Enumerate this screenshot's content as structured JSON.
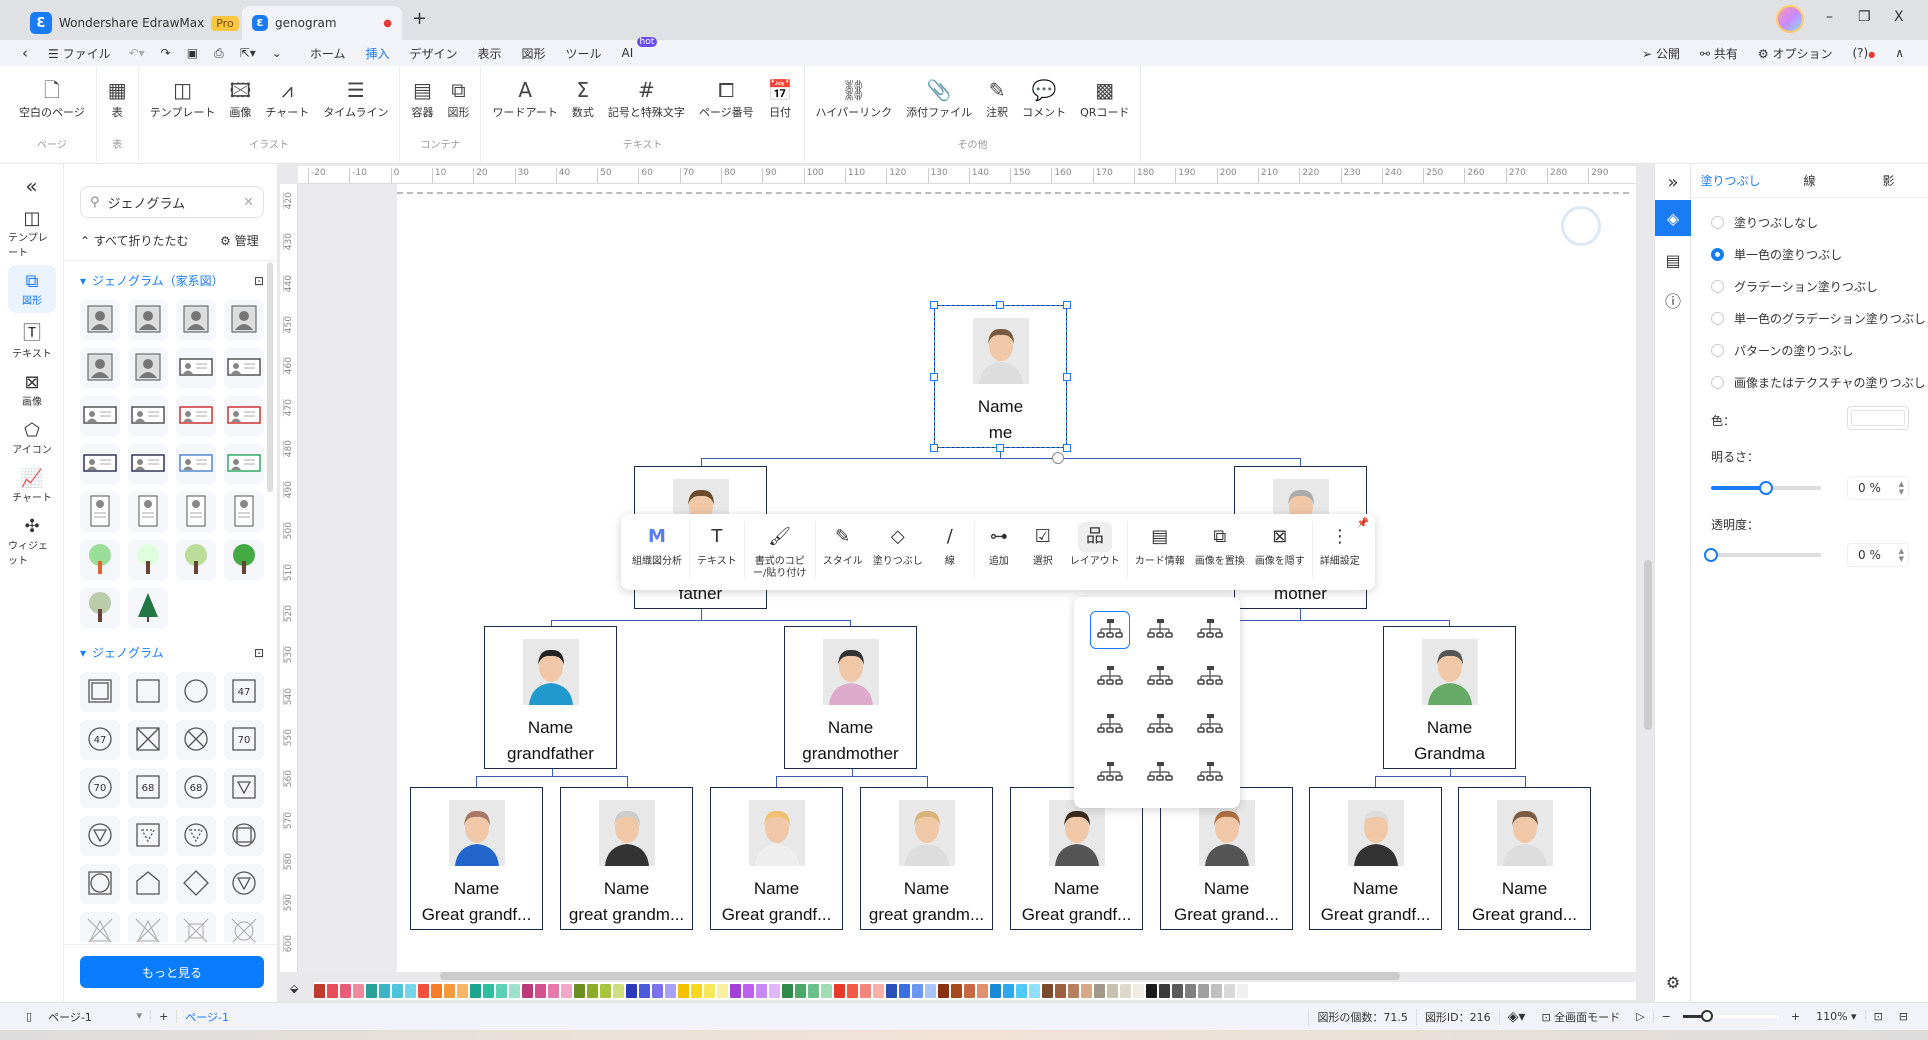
{
  "tabs": {
    "app": "Wondershare EdrawMax",
    "pro": "Pro",
    "doc": "genogram",
    "new_tab": "+"
  },
  "window": {
    "minimize": "–",
    "restore": "❐",
    "close": "X"
  },
  "menu": {
    "file": "ファイル",
    "items": [
      "ホーム",
      "挿入",
      "デザイン",
      "表示",
      "図形",
      "ツール",
      "AI"
    ],
    "active": "挿入",
    "hot": "hot",
    "publish": "公開",
    "share": "共有",
    "options": "オプション",
    "help": "?"
  },
  "ribbon": {
    "groups": [
      {
        "label": "ページ",
        "items": [
          {
            "label": "空白のページ",
            "icon": "blank-page-icon"
          }
        ]
      },
      {
        "label": "表",
        "items": [
          {
            "label": "表",
            "icon": "table-icon"
          }
        ]
      },
      {
        "label": "イラスト",
        "items": [
          {
            "label": "テンプレート",
            "icon": "template-icon"
          },
          {
            "label": "画像",
            "icon": "image-icon"
          },
          {
            "label": "チャート",
            "icon": "chart-icon"
          },
          {
            "label": "タイムライン",
            "icon": "timeline-icon"
          }
        ]
      },
      {
        "label": "コンテナ",
        "items": [
          {
            "label": "容器",
            "icon": "container-icon"
          },
          {
            "label": "図形",
            "icon": "shape-icon"
          }
        ]
      },
      {
        "label": "テキスト",
        "items": [
          {
            "label": "ワードアート",
            "icon": "wordart-icon"
          },
          {
            "label": "数式",
            "icon": "formula-icon"
          },
          {
            "label": "記号と特殊文字",
            "icon": "symbol-icon"
          },
          {
            "label": "ページ番号",
            "icon": "page-number-icon"
          },
          {
            "label": "日付",
            "icon": "date-icon"
          }
        ]
      },
      {
        "label": "その他",
        "items": [
          {
            "label": "ハイパーリンク",
            "icon": "hyperlink-icon"
          },
          {
            "label": "添付ファイル",
            "icon": "attachment-icon"
          },
          {
            "label": "注釈",
            "icon": "annotation-icon"
          },
          {
            "label": "コメント",
            "icon": "comment-icon"
          },
          {
            "label": "QRコード",
            "icon": "qr-code-icon"
          }
        ]
      }
    ]
  },
  "leftbar": [
    {
      "label": "テンプレート"
    },
    {
      "label": "図形"
    },
    {
      "label": "テキスト"
    },
    {
      "label": "画像"
    },
    {
      "label": "アイコン"
    },
    {
      "label": "チャート"
    },
    {
      "label": "ウィジェット"
    }
  ],
  "library": {
    "search": "ジェノグラム",
    "collapse_all": "すべて折りたたむ",
    "manage": "管理",
    "sections": [
      {
        "title": "ジェノグラム（家系図）"
      },
      {
        "title": "ジェノグラム"
      }
    ],
    "section1_icons": [
      "person-square",
      "person-circle",
      "person-frame",
      "person-frame-dark",
      "person-label",
      "person-label-round",
      "id-card",
      "id-card",
      "id-card",
      "id-card",
      "id-card-red",
      "id-card-red",
      "id-card-blue",
      "id-card-blue",
      "id-card-light-blue",
      "id-card-green",
      "portrait-card",
      "portrait-card",
      "portrait-card",
      "portrait-card",
      "tree-orange",
      "tree-pale",
      "tree-light",
      "tree-green",
      "tree-bare",
      "tree-pine"
    ],
    "section2_icons": [
      "double-square",
      "square",
      "circle",
      "square-47",
      "circle-47",
      "square-x",
      "circle-x",
      "square-70",
      "circle-70",
      "square-68",
      "circle-68",
      "square-triangle",
      "circle-triangle",
      "square-dotted-triangle",
      "circle-dotted-triangle",
      "circle-square",
      "square-circle",
      "pentagon",
      "diamond",
      "triangle",
      "cross-triangle",
      "cross-triangle-line",
      "square-cross",
      "circle-cross"
    ],
    "numbers": {
      "n47": "47",
      "n70": "70",
      "n68": "68"
    },
    "more": "もっと見る"
  },
  "ruler": {
    "h": [
      "-20",
      "-10",
      "0",
      "10",
      "20",
      "30",
      "40",
      "50",
      "60",
      "70",
      "80",
      "90",
      "100",
      "110",
      "120",
      "130",
      "140",
      "150",
      "160",
      "170",
      "180",
      "190",
      "200",
      "210",
      "220",
      "230",
      "240",
      "250",
      "260",
      "270",
      "280",
      "290"
    ],
    "v": [
      "420",
      "430",
      "440",
      "450",
      "460",
      "470",
      "480",
      "490",
      "500",
      "510",
      "520",
      "530",
      "540",
      "550",
      "560",
      "570",
      "580",
      "590",
      "600"
    ]
  },
  "tree": {
    "me": {
      "name": "Name",
      "role": "me"
    },
    "father": {
      "name": "Name",
      "role": "father"
    },
    "mother": {
      "name": "Name",
      "role": "mother"
    },
    "gen2": [
      {
        "name": "Name",
        "role": "grandfather"
      },
      {
        "name": "Name",
        "role": "grandmother"
      },
      {
        "name": "Name",
        "role": "Grandma"
      }
    ],
    "gen3": [
      {
        "name": "Name",
        "role": "Great grandf..."
      },
      {
        "name": "Name",
        "role": "great grandm..."
      },
      {
        "name": "Name",
        "role": "Great grandf..."
      },
      {
        "name": "Name",
        "role": "great grandm..."
      },
      {
        "name": "Name",
        "role": "Great grandf..."
      },
      {
        "name": "Name",
        "role": "Great grand..."
      },
      {
        "name": "Name",
        "role": "Great grandf..."
      },
      {
        "name": "Name",
        "role": "Great grand..."
      }
    ]
  },
  "floating_toolbar": [
    {
      "label": "組織図分析",
      "icon": "org-analysis-icon"
    },
    {
      "label": "テキスト",
      "icon": "text-icon"
    },
    {
      "label": "書式のコピー/貼り付け",
      "icon": "format-painter-icon"
    },
    {
      "label": "スタイル",
      "icon": "style-icon"
    },
    {
      "label": "塗りつぶし",
      "icon": "fill-icon"
    },
    {
      "label": "線",
      "icon": "line-icon"
    },
    {
      "label": "追加",
      "icon": "add-node-icon"
    },
    {
      "label": "選択",
      "icon": "select-icon"
    },
    {
      "label": "レイアウト",
      "icon": "layout-icon",
      "active": true
    },
    {
      "label": "カード情報",
      "icon": "card-info-icon"
    },
    {
      "label": "画像を置換",
      "icon": "replace-image-icon"
    },
    {
      "label": "画像を隠す",
      "icon": "hide-image-icon"
    },
    {
      "label": "詳細設定",
      "icon": "more-settings-icon"
    }
  ],
  "layout_options": [
    "org-tree-down",
    "right-aligned-tree",
    "left-aligned-tree",
    "right-branch",
    "left-branch",
    "both-sides-branch",
    "bottom-left-tree",
    "bottom-right-tree",
    "balanced-tree",
    "horizontal-tree",
    "upward-tree",
    "table-layout"
  ],
  "palette": [
    "#c0392b",
    "#e74c5a",
    "#e85c7a",
    "#f08aa0",
    "#2aa198",
    "#3bb5c4",
    "#4fc3d8",
    "#76d5ea",
    "#f0503c",
    "#f57c28",
    "#f59a3c",
    "#f5b764",
    "#1aa58c",
    "#2ebfa0",
    "#5cd0b5",
    "#9ee0cc",
    "#b83a78",
    "#d2508f",
    "#e47aac",
    "#f2a8cb",
    "#6a8f1e",
    "#8aac28",
    "#a8c43c",
    "#cde07c",
    "#2a3ab8",
    "#4a5ad8",
    "#7a70f0",
    "#a8a0f5",
    "#f5c000",
    "#f5d820",
    "#f5e85a",
    "#f8f0a0",
    "#a040d8",
    "#c060f0",
    "#c888f5",
    "#e0b8fa",
    "#2f8a4a",
    "#4aa868",
    "#6cc08a",
    "#a0dcb4",
    "#e83a2a",
    "#f05a48",
    "#f5847a",
    "#f8b0a8",
    "#2a50b8",
    "#3a70e0",
    "#6a98f0",
    "#a8c4f8",
    "#8a3010",
    "#a84a20",
    "#c86a40",
    "#e09070",
    "#1a8ad8",
    "#30a8f0",
    "#50c8f8",
    "#90e0fc",
    "#7a4a2a",
    "#9a6040",
    "#b88060",
    "#d8a888",
    "#a09888",
    "#c8c0b0",
    "#ddd8cc",
    "#f0ece4",
    "#1a1a1a",
    "#3a3a3a",
    "#5a5a5a",
    "#808080",
    "#a0a0a0",
    "#c0c0c0",
    "#d8d8d8",
    "#f0f0f0"
  ],
  "props": {
    "tabs": [
      "塗りつぶし",
      "線",
      "影"
    ],
    "active_tab": "塗りつぶし",
    "options": [
      "塗りつぶしなし",
      "単一色の塗りつぶし",
      "グラデーション塗りつぶし",
      "単一色のグラデーション塗りつぶし",
      "パターンの塗りつぶし",
      "画像またはテクスチャの塗りつぶし"
    ],
    "selected": "単一色の塗りつぶし",
    "color_label": "色：",
    "color_value": "#ffffff",
    "brightness_label": "明るさ：",
    "brightness": "0 %",
    "brightness_slider": 0.5,
    "transparency_label": "透明度：",
    "transparency": "0 %",
    "transparency_slider": 0
  },
  "status": {
    "page_select": "ページ-1",
    "add_page": "+",
    "page_tab": "ページ-1",
    "shape_count": "図形の個数：71.5",
    "shape_id": "図形ID：216",
    "fullscreen": "全画面モード",
    "zoom": "110%",
    "zoom_slider": 0.25,
    "zoom_out": "−",
    "zoom_in": "+"
  }
}
